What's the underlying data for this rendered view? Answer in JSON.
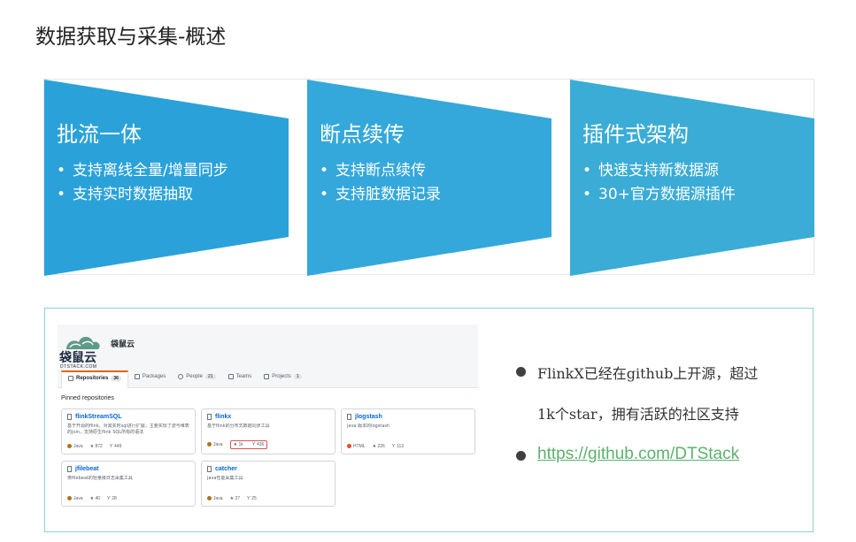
{
  "page": {
    "title": "数据获取与采集-概述"
  },
  "colors": {
    "panel_1": "#2aa2d9",
    "panel_2": "#34a8db",
    "panel_3": "#3aacd6",
    "info_border": "#8ed0d8",
    "link": "#5bb26e"
  },
  "features": [
    {
      "title": "批流一体",
      "items": [
        "支持离线全量/增量同步",
        "支持实时数据抽取"
      ]
    },
    {
      "title": "断点续传",
      "items": [
        "支持断点续传",
        "支持脏数据记录"
      ]
    },
    {
      "title": "插件式架构",
      "items": [
        "快速支持新数据源",
        "30+官方数据源插件"
      ]
    }
  ],
  "bullet_symbol": "•",
  "info": {
    "line_1": "FlinkX已经在github上开源，超过",
    "line_2": "1k个star，拥有活跃的社区支持",
    "link": "https://github.com/DTStack"
  },
  "github": {
    "logo_text": "袋鼠云",
    "logo_sub": "DTSTACK.COM",
    "org_name": "袋鼠云",
    "tabs": [
      {
        "label": "Repositories",
        "count": "36"
      },
      {
        "label": "Packages",
        "count": ""
      },
      {
        "label": "People",
        "count": "21"
      },
      {
        "label": "Teams",
        "count": ""
      },
      {
        "label": "Projects",
        "count": "1"
      }
    ],
    "pinned_label": "Pinned repositories",
    "repos": [
      {
        "name": "flinkStreamSQL",
        "desc": "基于开源的flink，对其实时sql进行扩展；主要实现了流与维表的join，支持原生flink SQL所有的语法",
        "lang": "Java",
        "lang_color": "#b07219",
        "stars": "872",
        "forks": "449"
      },
      {
        "name": "flinkx",
        "desc": "基于flink的分布式数据同步工具",
        "lang": "Java",
        "lang_color": "#b07219",
        "stars": "1k",
        "forks": "436"
      },
      {
        "name": "jlogstash",
        "desc": "java 版本的logstash",
        "lang": "HTML",
        "lang_color": "#e34c26",
        "stars": "226",
        "forks": "113"
      },
      {
        "name": "jfilebeat",
        "desc": "类filebeat的轻量级日志采集工具",
        "lang": "Java",
        "lang_color": "#b07219",
        "stars": "40",
        "forks": "28"
      },
      {
        "name": "catcher",
        "desc": "java性能采集工具",
        "lang": "Java",
        "lang_color": "#b07219",
        "stars": "27",
        "forks": "25"
      }
    ],
    "star_symbol": "★",
    "fork_symbol": "Ƴ"
  }
}
